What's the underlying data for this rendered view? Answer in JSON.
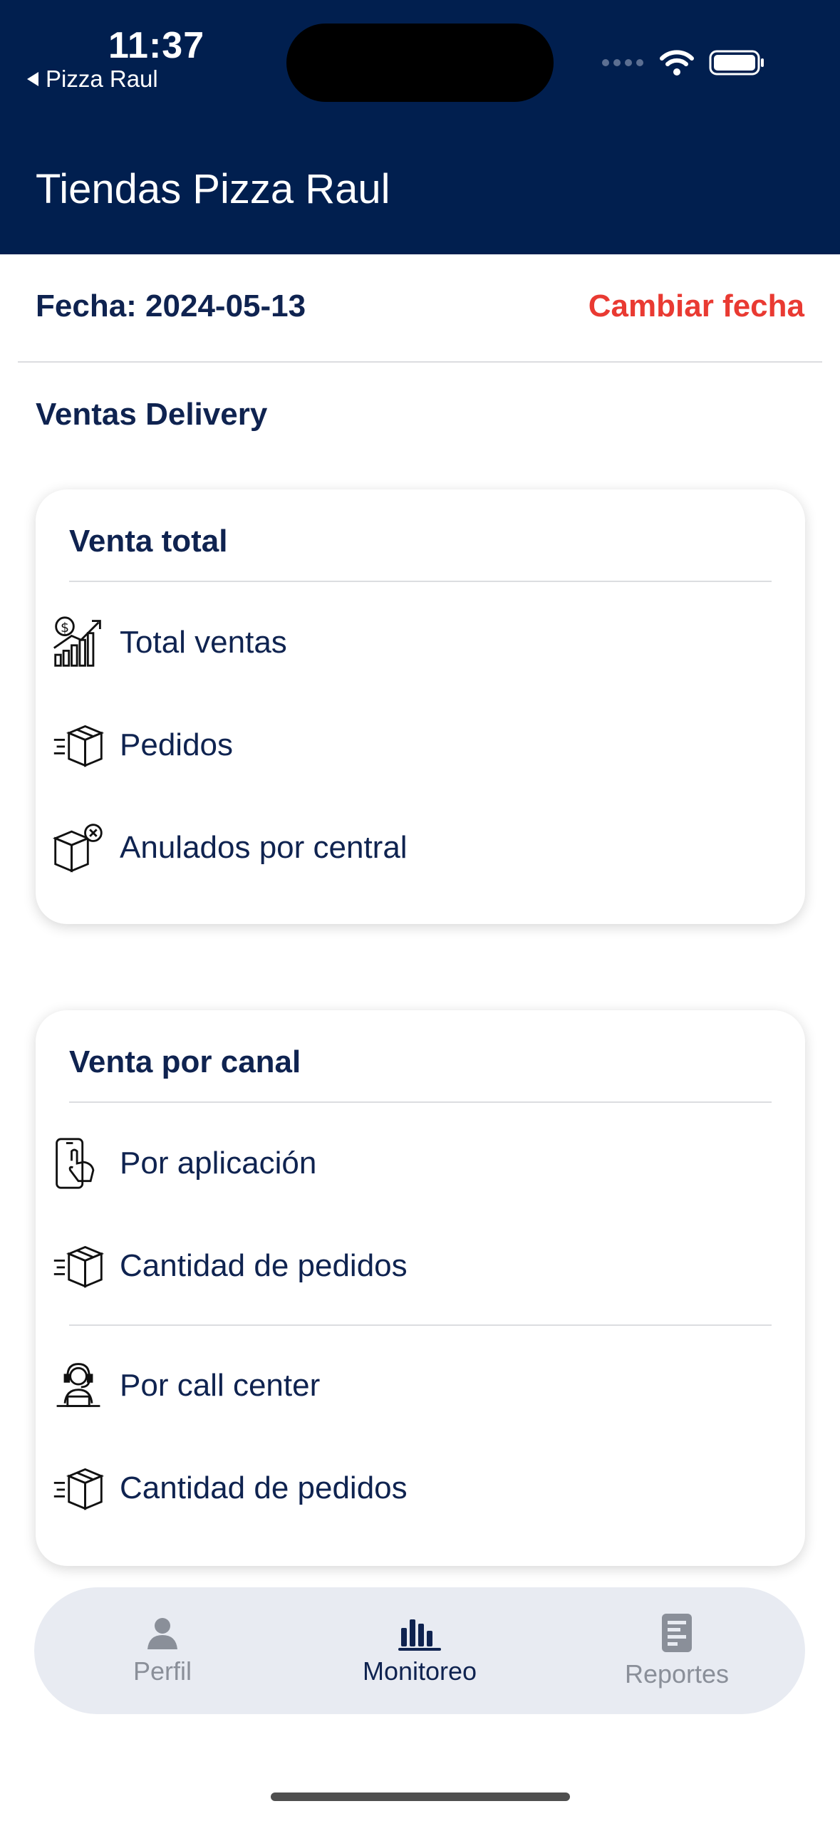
{
  "status_bar": {
    "time": "11:37",
    "back_app": "Pizza Raul"
  },
  "header": {
    "title": "Tiendas Pizza Raul"
  },
  "date": {
    "label": "Fecha: 2024-05-13",
    "change": "Cambiar fecha"
  },
  "section": {
    "title": "Ventas Delivery"
  },
  "card_total": {
    "title": "Venta total",
    "rows": [
      {
        "label": "Total ventas",
        "icon": "sales-growth-icon"
      },
      {
        "label": "Pedidos",
        "icon": "package-delivery-icon"
      },
      {
        "label": "Anulados por central",
        "icon": "package-cancel-icon"
      }
    ]
  },
  "card_canal": {
    "title": "Venta por canal",
    "rows": [
      {
        "label": "Por aplicación",
        "icon": "phone-tap-icon"
      },
      {
        "label": "Cantidad de pedidos",
        "icon": "package-delivery-icon"
      },
      {
        "label": "Por call center",
        "icon": "call-center-agent-icon"
      },
      {
        "label": "Cantidad de pedidos",
        "icon": "package-delivery-icon"
      }
    ]
  },
  "tabbar": {
    "tabs": [
      {
        "label": "Perfil",
        "icon": "person-icon",
        "active": false
      },
      {
        "label": "Monitoreo",
        "icon": "bar-chart-icon",
        "active": true
      },
      {
        "label": "Reportes",
        "icon": "report-icon",
        "active": false
      }
    ]
  },
  "colors": {
    "header_bg": "#011f4f",
    "accent_red": "#e93a32",
    "text_navy": "#0f2350",
    "tab_inactive": "#8a8f99"
  }
}
